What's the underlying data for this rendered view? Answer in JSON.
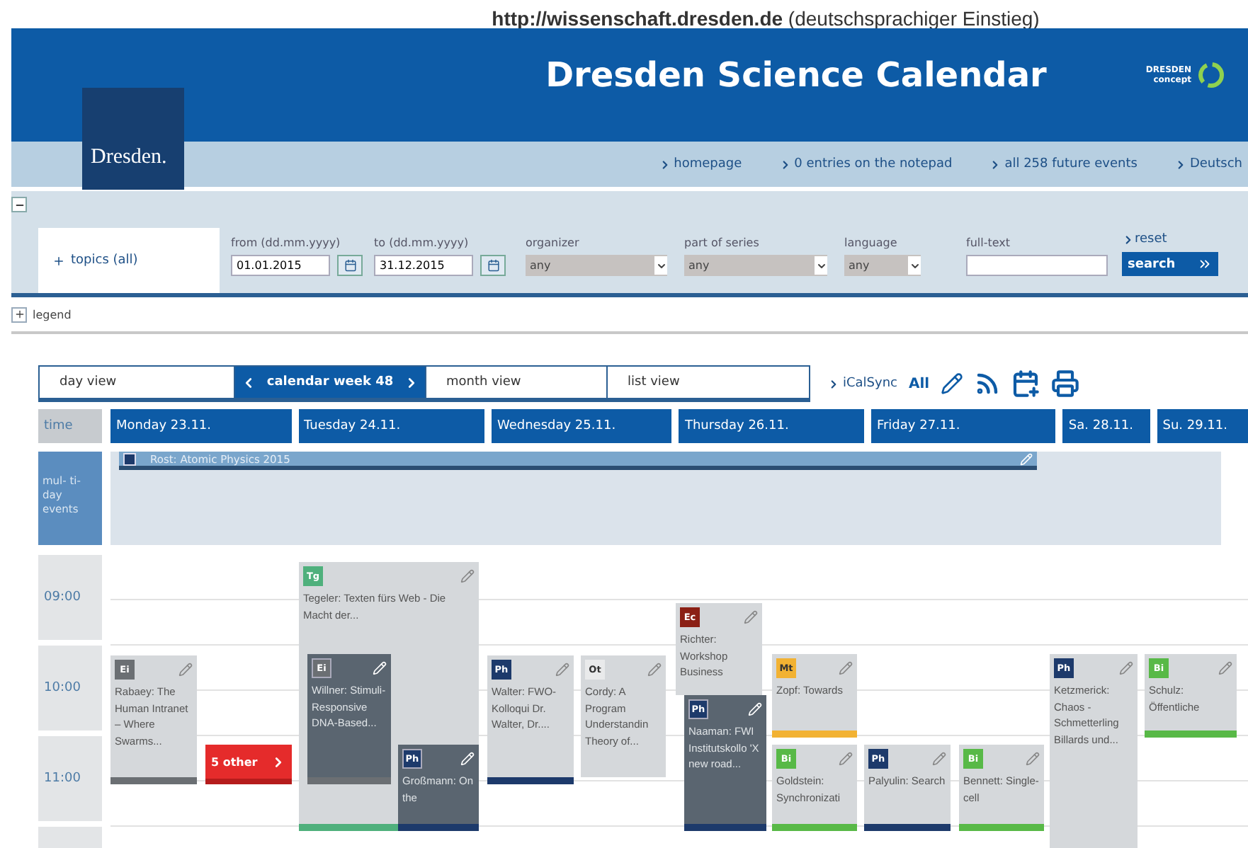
{
  "caption": "**http://wissenschaft.dresden.de** (deutschsprachiger Einstieg)",
  "header": {
    "title": "Dresden Science Calendar",
    "city_logo": "Dresden.",
    "partner_logo": [
      "DRESDEN",
      "concept"
    ]
  },
  "nav": [
    "homepage",
    "0 entries on the notepad",
    "all 258 future events",
    "Deutsch"
  ],
  "filters": {
    "topics": "topics (all)",
    "dates": [
      {
        "label": "from (dd.mm.yyyy)",
        "value": "01.01.2015"
      },
      {
        "label": "to (dd.mm.yyyy)",
        "value": "31.12.2015"
      }
    ],
    "selects": [
      {
        "label": "organizer",
        "value": "any"
      },
      {
        "label": "part of series",
        "value": "any"
      },
      {
        "label": "language",
        "value": "any"
      }
    ],
    "fulltext": {
      "label": "full-text"
    },
    "reset": "reset",
    "search": "search"
  },
  "legend": "legend",
  "views": [
    {
      "label": "day view",
      "selected": false
    },
    {
      "label": "calendar week 48",
      "selected": true
    },
    {
      "label": "month view",
      "selected": false
    },
    {
      "label": "list view",
      "selected": false
    }
  ],
  "ical": "iCalSync",
  "all": "All",
  "time_label": "time",
  "days": [
    "Monday 23.11.",
    "Tuesday 24.11.",
    "Wednesday 25.11.",
    "Thursday 26.11.",
    "Friday 27.11.",
    "Sa. 28.11.",
    "Su. 29.11."
  ],
  "multiday": {
    "label": "mul- ti-day events",
    "events": [
      {
        "title": "Rost: Atomic Physics 2015"
      }
    ]
  },
  "times": [
    "09:00",
    "10:00",
    "11:00"
  ],
  "events": [
    {
      "kind": "light",
      "badge": "Ei",
      "color": "#6b6f73",
      "title": "Rabaey: The Human Intranet – Where Swarms..."
    },
    {
      "kind": "more",
      "title": "5 other"
    },
    {
      "kind": "light",
      "badge": "Tg",
      "color": "#4fb07c",
      "title": "Tegeler: Texten fürs Web - Die Macht der..."
    },
    {
      "kind": "dark",
      "badge": "Ei",
      "color": "#6b6f73",
      "title": "Willner: Stimuli-Responsive DNA-Based..."
    },
    {
      "kind": "dark",
      "badge": "Ph",
      "color": "#1d3a6b",
      "title": "Großmann: On the"
    },
    {
      "kind": "light",
      "badge": "Ph",
      "color": "#1d3a6b",
      "title": "Walter: FWO-Kolloqui Dr. Walter, Dr...."
    },
    {
      "kind": "light",
      "badge": "Ot",
      "color": "#e9eaeb",
      "title": "Cordy: A Program Understandin Theory of..."
    },
    {
      "kind": "light",
      "badge": "Ec",
      "color": "#8b2015",
      "title": "Richter: Workshop Business"
    },
    {
      "kind": "dark",
      "badge": "Ph",
      "color": "#1d3a6b",
      "title": "Naaman: FWI Institutskollo 'X new road..."
    },
    {
      "kind": "light",
      "badge": "Mt",
      "color": "#f2b233",
      "title": "Zopf: Towards"
    },
    {
      "kind": "light",
      "badge": "Bi",
      "color": "#58b947",
      "title": "Goldstein: Synchronizati"
    },
    {
      "kind": "light",
      "badge": "Ph",
      "color": "#1d3a6b",
      "title": "Palyulin: Search"
    },
    {
      "kind": "light",
      "badge": "Bi",
      "color": "#58b947",
      "title": "Bennett: Single-cell"
    },
    {
      "kind": "light",
      "badge": "Ph",
      "color": "#1d3a6b",
      "title": "Ketzmerick: Chaos - Schmetterling Billards und..."
    },
    {
      "kind": "light",
      "badge": "Bi",
      "color": "#58b947",
      "title": "Schulz: Öffentliche"
    }
  ]
}
